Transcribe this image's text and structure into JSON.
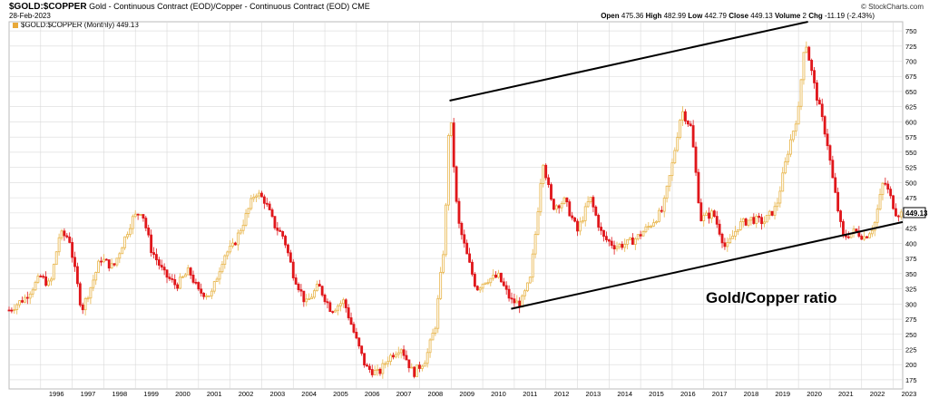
{
  "header": {
    "symbol": "$GOLD:$COPPER",
    "description": "Gold - Continuous Contract (EOD)/Copper - Continuous Contract (EOD)",
    "exchange": "CME",
    "date": "28-Feb-2023",
    "brand": "© StockCharts.com",
    "ohlc": {
      "open_label": "Open",
      "open": "475.36",
      "high_label": "High",
      "high": "482.99",
      "low_label": "Low",
      "low": "442.79",
      "close_label": "Close",
      "close": "449.13",
      "volume_label": "Volume",
      "volume": "2",
      "chg_label": "Chg",
      "chg": "-11.19 (-2.43%)"
    },
    "legend": "$GOLD:$COPPER (Monthly) 449.13"
  },
  "colors": {
    "up": "#e8b54a",
    "down": "#e0161b",
    "trend": "#000000",
    "grid": "#d9d9d9",
    "last_tag_bg": "#ffffff"
  },
  "chart_data": {
    "type": "candlestick",
    "period": "Monthly",
    "annotation": "Gold/Copper ratio",
    "last_value": "449.13",
    "x_years": [
      "1996",
      "1997",
      "1998",
      "1999",
      "2000",
      "2001",
      "2002",
      "2003",
      "2004",
      "2005",
      "2006",
      "2007",
      "2008",
      "2009",
      "2010",
      "2011",
      "2012",
      "2013",
      "2014",
      "2015",
      "2016",
      "2017",
      "2018",
      "2019",
      "2020",
      "2021",
      "2022",
      "2023"
    ],
    "x_range": [
      1995.0,
      2023.3
    ],
    "y_ticks": [
      175,
      200,
      225,
      250,
      275,
      300,
      325,
      350,
      375,
      400,
      425,
      450,
      475,
      500,
      525,
      550,
      575,
      600,
      625,
      650,
      675,
      700,
      725,
      750
    ],
    "ylim": [
      160,
      765
    ],
    "approx_monthly_close": [
      [
        1995.0,
        290
      ],
      [
        1995.5,
        310
      ],
      [
        1996.0,
        345
      ],
      [
        1996.3,
        330
      ],
      [
        1996.6,
        415
      ],
      [
        1996.9,
        410
      ],
      [
        1997.3,
        290
      ],
      [
        1997.6,
        330
      ],
      [
        1997.9,
        375
      ],
      [
        1998.3,
        360
      ],
      [
        1998.6,
        400
      ],
      [
        1998.9,
        440
      ],
      [
        1999.2,
        455
      ],
      [
        1999.5,
        390
      ],
      [
        1999.9,
        350
      ],
      [
        2000.3,
        330
      ],
      [
        2000.7,
        355
      ],
      [
        2001.0,
        320
      ],
      [
        2001.4,
        315
      ],
      [
        2001.8,
        380
      ],
      [
        2002.1,
        395
      ],
      [
        2002.5,
        445
      ],
      [
        2002.8,
        485
      ],
      [
        2003.1,
        470
      ],
      [
        2003.4,
        430
      ],
      [
        2003.7,
        410
      ],
      [
        2004.0,
        350
      ],
      [
        2004.4,
        300
      ],
      [
        2004.8,
        330
      ],
      [
        2005.2,
        290
      ],
      [
        2005.6,
        305
      ],
      [
        2006.0,
        240
      ],
      [
        2006.3,
        195
      ],
      [
        2006.7,
        185
      ],
      [
        2007.0,
        210
      ],
      [
        2007.4,
        230
      ],
      [
        2007.8,
        185
      ],
      [
        2008.2,
        210
      ],
      [
        2008.5,
        265
      ],
      [
        2008.8,
        410
      ],
      [
        2008.95,
        630
      ],
      [
        2009.2,
        440
      ],
      [
        2009.5,
        380
      ],
      [
        2009.8,
        325
      ],
      [
        2010.1,
        340
      ],
      [
        2010.5,
        345
      ],
      [
        2010.9,
        305
      ],
      [
        2011.2,
        300
      ],
      [
        2011.5,
        340
      ],
      [
        2011.7,
        430
      ],
      [
        2011.9,
        540
      ],
      [
        2012.2,
        460
      ],
      [
        2012.6,
        470
      ],
      [
        2013.0,
        420
      ],
      [
        2013.4,
        475
      ],
      [
        2013.8,
        410
      ],
      [
        2014.2,
        395
      ],
      [
        2014.6,
        400
      ],
      [
        2014.9,
        410
      ],
      [
        2015.3,
        430
      ],
      [
        2015.7,
        455
      ],
      [
        2016.0,
        530
      ],
      [
        2016.3,
        620
      ],
      [
        2016.6,
        590
      ],
      [
        2016.9,
        440
      ],
      [
        2017.3,
        450
      ],
      [
        2017.7,
        390
      ],
      [
        2018.1,
        430
      ],
      [
        2018.5,
        440
      ],
      [
        2018.9,
        435
      ],
      [
        2019.3,
        460
      ],
      [
        2019.7,
        560
      ],
      [
        2020.0,
        620
      ],
      [
        2020.2,
        740
      ],
      [
        2020.5,
        660
      ],
      [
        2020.9,
        570
      ],
      [
        2021.1,
        500
      ],
      [
        2021.4,
        410
      ],
      [
        2021.8,
        420
      ],
      [
        2022.1,
        410
      ],
      [
        2022.4,
        430
      ],
      [
        2022.7,
        505
      ],
      [
        2022.95,
        470
      ],
      [
        2023.1,
        449.13
      ]
    ],
    "trendlines": [
      {
        "from": [
          2008.95,
          635
        ],
        "to": [
          2020.3,
          765
        ]
      },
      {
        "from": [
          2010.9,
          292
        ],
        "to": [
          2023.3,
          435
        ]
      }
    ]
  }
}
